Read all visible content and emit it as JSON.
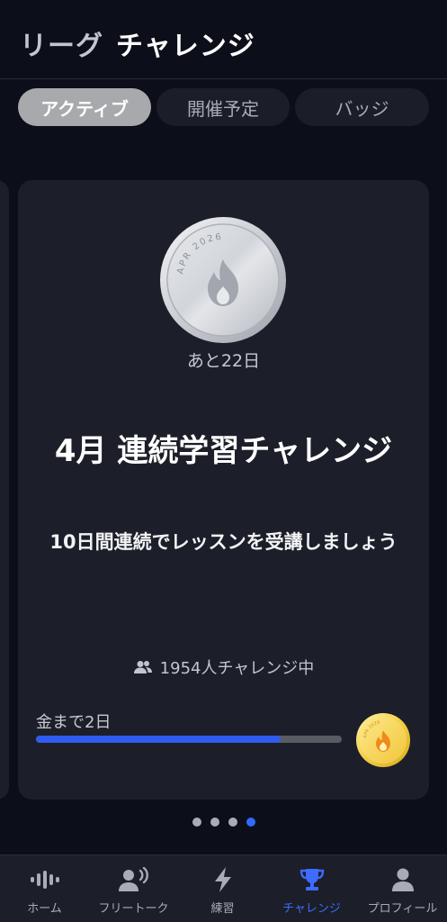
{
  "header": {
    "title_part1": "リーグ",
    "title_part2": "チャレンジ"
  },
  "tabs": [
    {
      "label": "アクティブ",
      "active": true
    },
    {
      "label": "開催予定",
      "active": false
    },
    {
      "label": "バッジ",
      "active": false
    }
  ],
  "card": {
    "medal_text": "APR 2026",
    "days_left": "あと22日",
    "title": "4月 連続学習チャレンジ",
    "description": "10日間連続でレッスンを受講しましょう",
    "participants": "1954人チャレンジ中",
    "goal_label": "金まで2日",
    "progress_fraction": 0.8,
    "gold_medal_text": "APR 2026"
  },
  "pagination": {
    "count": 4,
    "active_index": 3
  },
  "bottom_nav": [
    {
      "label": "ホーム",
      "icon": "waveform-icon",
      "active": false
    },
    {
      "label": "フリートーク",
      "icon": "speaking-person-icon",
      "active": false
    },
    {
      "label": "練習",
      "icon": "lightning-icon",
      "active": false
    },
    {
      "label": "チャレンジ",
      "icon": "trophy-icon",
      "active": true
    },
    {
      "label": "プロフィール",
      "icon": "person-icon",
      "active": false
    }
  ],
  "colors": {
    "background": "#0c0f1a",
    "card": "#1c1f29",
    "accent": "#2f5bf0",
    "nav_active": "#3f6bff"
  }
}
